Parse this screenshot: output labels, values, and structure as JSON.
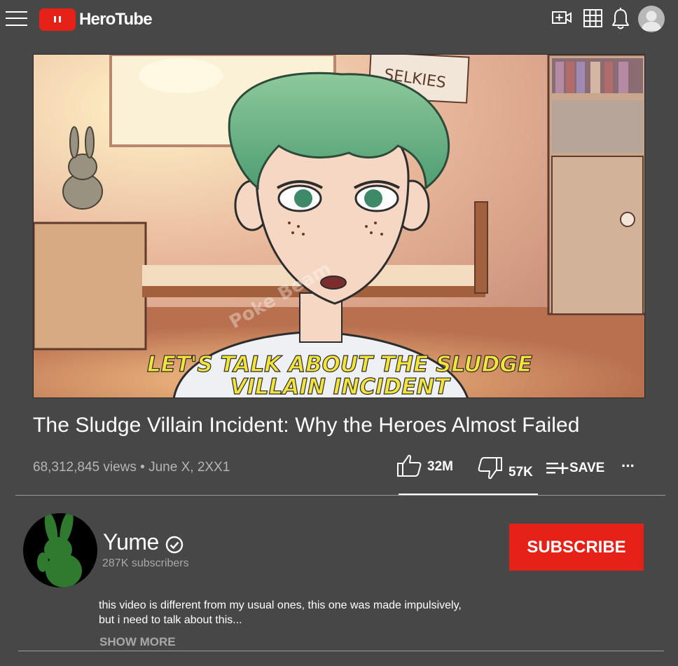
{
  "app": {
    "name": "HeroTube"
  },
  "video": {
    "caption_line1": "LET'S TALK ABOUT THE SLUDGE",
    "caption_line2": "VILLAIN INCIDENT",
    "poster_text": "SELKIES",
    "watermark": "Poke Beam",
    "title": "The Sludge Villain Incident: Why the Heroes Almost Failed",
    "views": "68,312,845 views",
    "separator": "•",
    "date": "June X, 2XX1",
    "likes": "32M",
    "dislikes": "57K",
    "save_label": "SAVE",
    "more": "···",
    "like_ratio": 0.998
  },
  "channel": {
    "name": "Yume",
    "subscribers": "287K subscribers",
    "subscribe_label": "SUBSCRIBE"
  },
  "description": {
    "line1": "this video is different from my usual ones, this one was made impulsively,",
    "line2": "but i need to talk about this...",
    "show_more": "SHOW MORE"
  },
  "icons": {
    "menu": "hamburger-menu-icon",
    "upload": "video-camera-plus-icon",
    "apps": "apps-grid-icon",
    "notifications": "bell-icon",
    "account": "avatar-icon",
    "like": "thumbs-up-icon",
    "dislike": "thumbs-down-icon",
    "save": "playlist-add-icon",
    "verified": "check-circle-icon"
  },
  "colors": {
    "background": "#474747",
    "brand": "#e62117",
    "text": "#ffffff",
    "muted": "#b5b5b5",
    "caption": "#f2e43a"
  }
}
